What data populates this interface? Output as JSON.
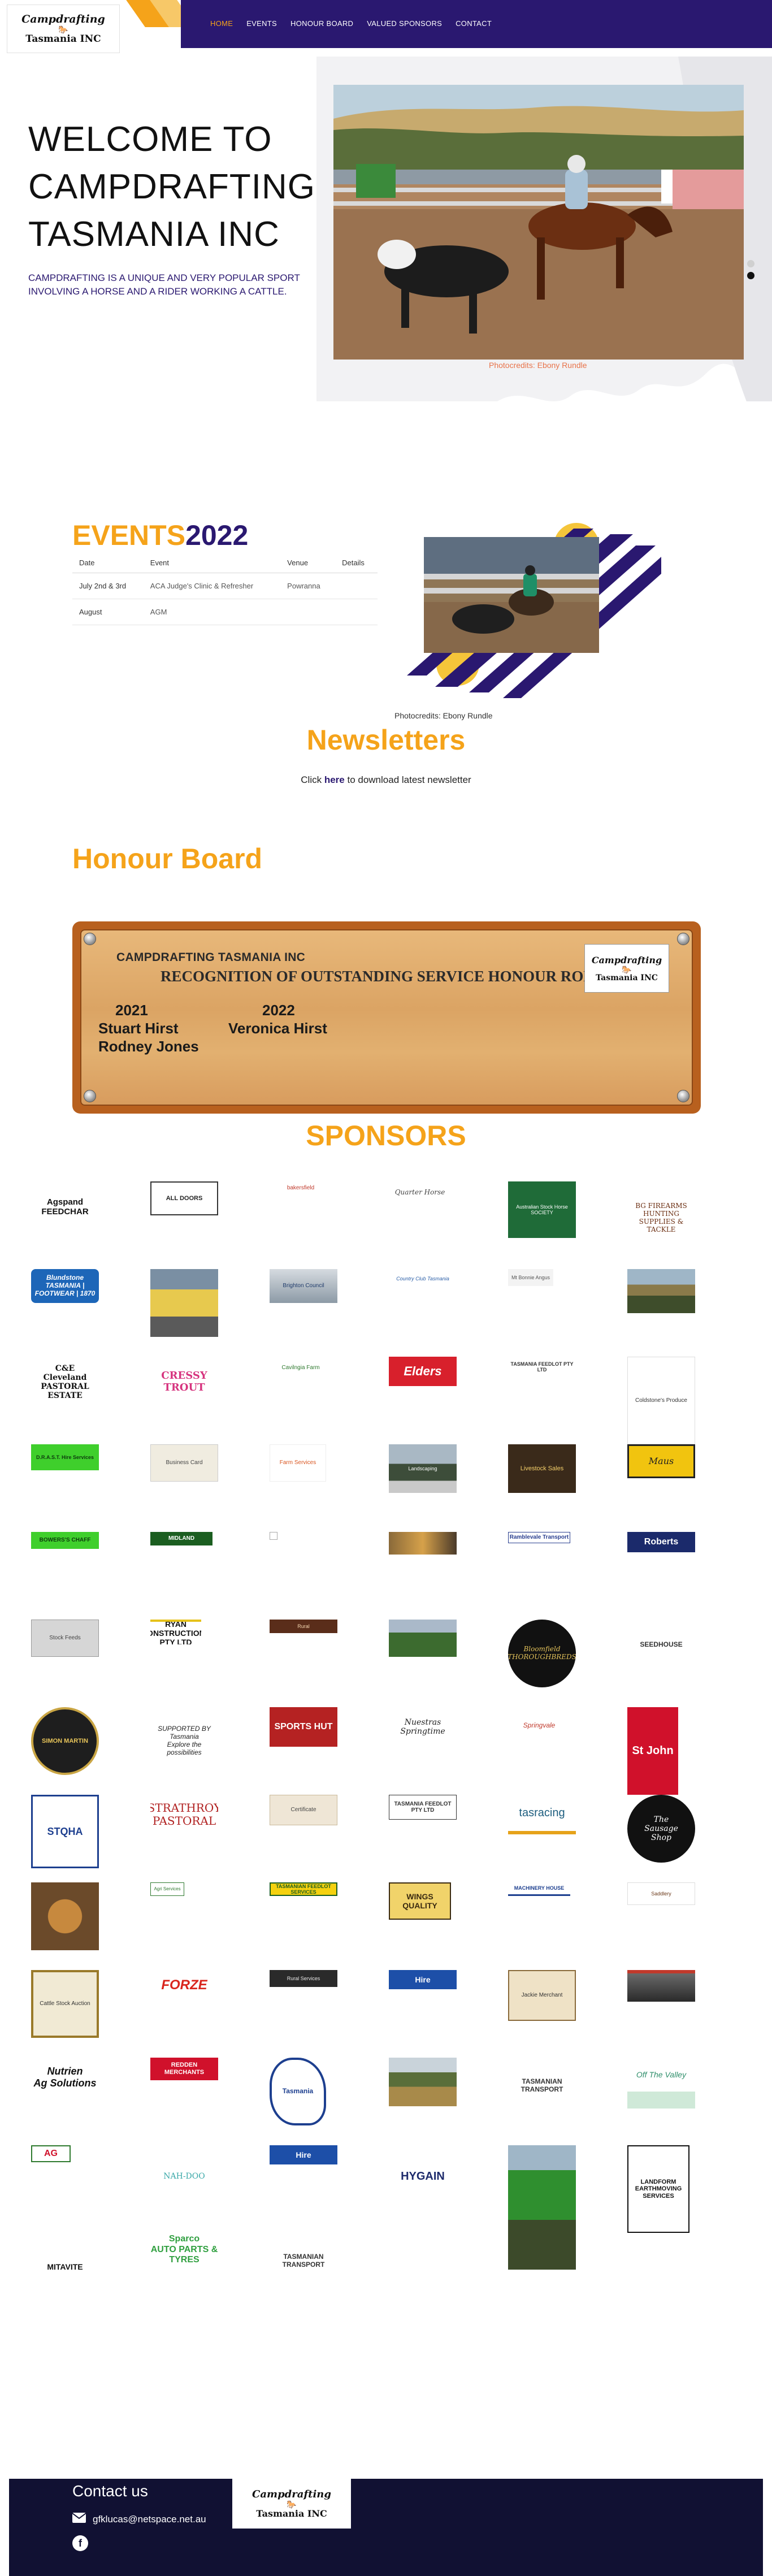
{
  "logo": {
    "line1": "Campdrafting",
    "line2": "Tasmania INC",
    "horse": "🐎"
  },
  "nav": [
    {
      "label": "HOME",
      "active": true
    },
    {
      "label": "EVENTS",
      "active": false
    },
    {
      "label": "HONOUR BOARD",
      "active": false
    },
    {
      "label": "VALUED SPONSORS",
      "active": false
    },
    {
      "label": "CONTACT",
      "active": false
    }
  ],
  "hero": {
    "title_lines": [
      "WELCOME TO",
      "CAMPDRAFTING",
      "TASMANIA INC"
    ],
    "description": "CAMPDRAFTING IS A UNIQUE AND VERY POPULAR SPORT INVOLVING A HORSE AND A RIDER WORKING A CATTLE.",
    "photo_credit": "Photocredits: Ebony Rundle",
    "slide_count": 2,
    "active_slide": 1
  },
  "events": {
    "heading_part1": "EVENTS",
    "heading_part2": "2022",
    "columns": [
      "Date",
      "Event",
      "Venue",
      "Details"
    ],
    "rows": [
      {
        "date": "July 2nd & 3rd",
        "event": "ACA Judge's Clinic & Refresher",
        "venue": "Powranna",
        "details": ""
      },
      {
        "date": "August",
        "event": "AGM",
        "venue": "",
        "details": ""
      }
    ],
    "photo_credit": "Photocredits: Ebony Rundle"
  },
  "newsletters": {
    "heading": "Newsletters",
    "text_before": "Click ",
    "link": "here",
    "text_after": " to download latest newsletter"
  },
  "honour": {
    "heading": "Honour Board",
    "org": "CAMPDRAFTING TASMANIA INC",
    "title": "RECOGNITION OF OUTSTANDING SERVICE HONOUR ROLL",
    "year1": "2021",
    "year2": "2022",
    "names_2021": [
      "Stuart Hirst",
      "Rodney Jones"
    ],
    "names_2022": [
      "Veronica Hirst"
    ]
  },
  "sponsors": {
    "heading": "SPONSORS",
    "items": [
      {
        "text": "Agspand\nFEEDCHAR",
        "style": "agspand"
      },
      {
        "text": "ALL DOORS",
        "style": "alldoors"
      },
      {
        "text": "bakersfield",
        "style": "redsmall"
      },
      {
        "text": "Quarter Horse",
        "style": "script"
      },
      {
        "text": "Australian Stock Horse SOCIETY",
        "style": "ash"
      },
      {
        "text": "BG FIREARMS\nHUNTING SUPPLIES & TACKLE",
        "style": "bgfirearms"
      },
      {
        "text": "Blundstone\nTASMANIA | FOOTWEAR | 1870",
        "style": "blundstone"
      },
      {
        "text": "",
        "style": "photo-yellow"
      },
      {
        "text": "Brighton Council",
        "style": "smallphoto"
      },
      {
        "text": "Country Club Tasmania",
        "style": "bluescript"
      },
      {
        "text": "Mt Bonnie Angus",
        "style": "tinygray"
      },
      {
        "text": "",
        "style": "photo-land"
      },
      {
        "text": "C&E\nCleveland\nPASTORAL ESTATE",
        "style": "cleveland"
      },
      {
        "text": "CRESSY\nTROUT",
        "style": "cressy"
      },
      {
        "text": "Cavilngia Farm",
        "style": "greensmall"
      },
      {
        "text": "Elders",
        "style": "elders"
      },
      {
        "text": "TASMANIA FEEDLOT PTY LTD",
        "style": "feedlot"
      },
      {
        "text": "Coldstone's Produce",
        "style": "produce"
      },
      {
        "text": "D.R.A.S.T. Hire Services",
        "style": "greenlabel"
      },
      {
        "text": "Business Card",
        "style": "card"
      },
      {
        "text": "Farm Services",
        "style": "orangecard"
      },
      {
        "text": "Landscaping",
        "style": "photo-truck"
      },
      {
        "text": "Livestock Sales",
        "style": "darkcard"
      },
      {
        "text": "Maus",
        "style": "maus"
      },
      {
        "text": "BOWERS'S CHAFF",
        "style": "bowers"
      },
      {
        "text": "MIDLAND",
        "style": "midland"
      },
      {
        "text": "",
        "style": "broken"
      },
      {
        "text": "",
        "style": "photo-sunset"
      },
      {
        "text": "Ramblevale Transport",
        "style": "ramble"
      },
      {
        "text": "Roberts",
        "style": "roberts"
      },
      {
        "text": "Stock Feeds",
        "style": "grayimg"
      },
      {
        "text": "RYAN\nCONSTRUCTIONS PTY LTD",
        "style": "ryan"
      },
      {
        "text": "Rural",
        "style": "brownbar"
      },
      {
        "text": "",
        "style": "photo-field"
      },
      {
        "text": "Bloomfield\nTHOROUGHBREDS",
        "style": "blackcircle"
      },
      {
        "text": "SEEDHOUSE",
        "style": "seedhouse"
      },
      {
        "text": "SIMON MARTIN",
        "style": "simon"
      },
      {
        "text": "SUPPORTED BY\nTasmania\nExplore the possibilities",
        "style": "tasmania"
      },
      {
        "text": "SPORTS HUT",
        "style": "sportshut"
      },
      {
        "text": "Nuestras\nSpringtime",
        "style": "scriptdark"
      },
      {
        "text": "Springvale",
        "style": "springvale"
      },
      {
        "text": "St John",
        "style": "stjohn"
      },
      {
        "text": "STQHA",
        "style": "stqha"
      },
      {
        "text": "STRATHROY\nPASTORAL",
        "style": "strathroy"
      },
      {
        "text": "Certificate",
        "style": "certificate"
      },
      {
        "text": "TASMANIA FEEDLOT PTY LTD",
        "style": "feedlot2"
      },
      {
        "text": "tasracing",
        "style": "tasracing"
      },
      {
        "text": "The\nSausage\nShop",
        "style": "sausage"
      },
      {
        "text": "",
        "style": "photo-saddle"
      },
      {
        "text": "Agri Services",
        "style": "tinybanner"
      },
      {
        "text": "TASMANIAN FEEDLOT SERVICES",
        "style": "yellowbanner"
      },
      {
        "text": "WINGS\nQUALITY",
        "style": "wings"
      },
      {
        "text": "MACHINERY HOUSE",
        "style": "blueline"
      },
      {
        "text": "Saddlery",
        "style": "tinylogo"
      },
      {
        "text": "Cattle Stock Auction",
        "style": "photo-poster"
      },
      {
        "text": "FORZE",
        "style": "forze"
      },
      {
        "text": "Rural Services",
        "style": "darkbanner"
      },
      {
        "text": "Hire",
        "style": "hire"
      },
      {
        "text": "Jackie Merchant",
        "style": "photo-card"
      },
      {
        "text": "",
        "style": "photo-slim"
      },
      {
        "text": "Nutrien\nAg Solutions",
        "style": "nutrien"
      },
      {
        "text": "REDDEN\nMERCHANTS",
        "style": "redden"
      },
      {
        "text": "Tasmania",
        "style": "tasmap"
      },
      {
        "text": "",
        "style": "photo-sign"
      },
      {
        "text": "TASMANIAN\nTRANSPORT",
        "style": "transport"
      },
      {
        "text": "Off The Valley",
        "style": "valley"
      },
      {
        "text": "AG",
        "style": "ag"
      },
      {
        "text": "NAH-DOO",
        "style": "nahdoo"
      },
      {
        "text": "Hire",
        "style": "hire2"
      },
      {
        "text": "HYGAIN",
        "style": "hygain"
      },
      {
        "text": "",
        "style": "photo-tractor"
      },
      {
        "text": "LANDFORM\nEARTHMOVING\nSERVICES",
        "style": "landform"
      },
      {
        "text": "MITAVITE",
        "style": "mitavite"
      },
      {
        "text": "Sparco\nAUTO PARTS & TYRES",
        "style": "sparco"
      },
      {
        "text": "TASMANIAN\nTRANSPORT",
        "style": "transport2"
      }
    ]
  },
  "footer": {
    "title": "Contact us",
    "email": "gfklucas@netspace.net.au",
    "facebook": "f",
    "logo_line1": "Campdrafting",
    "logo_line2": "Tasmania INC"
  },
  "colors": {
    "brand_navy": "#2a1870",
    "brand_orange": "#f5a31a",
    "footer_bg": "#111133"
  }
}
